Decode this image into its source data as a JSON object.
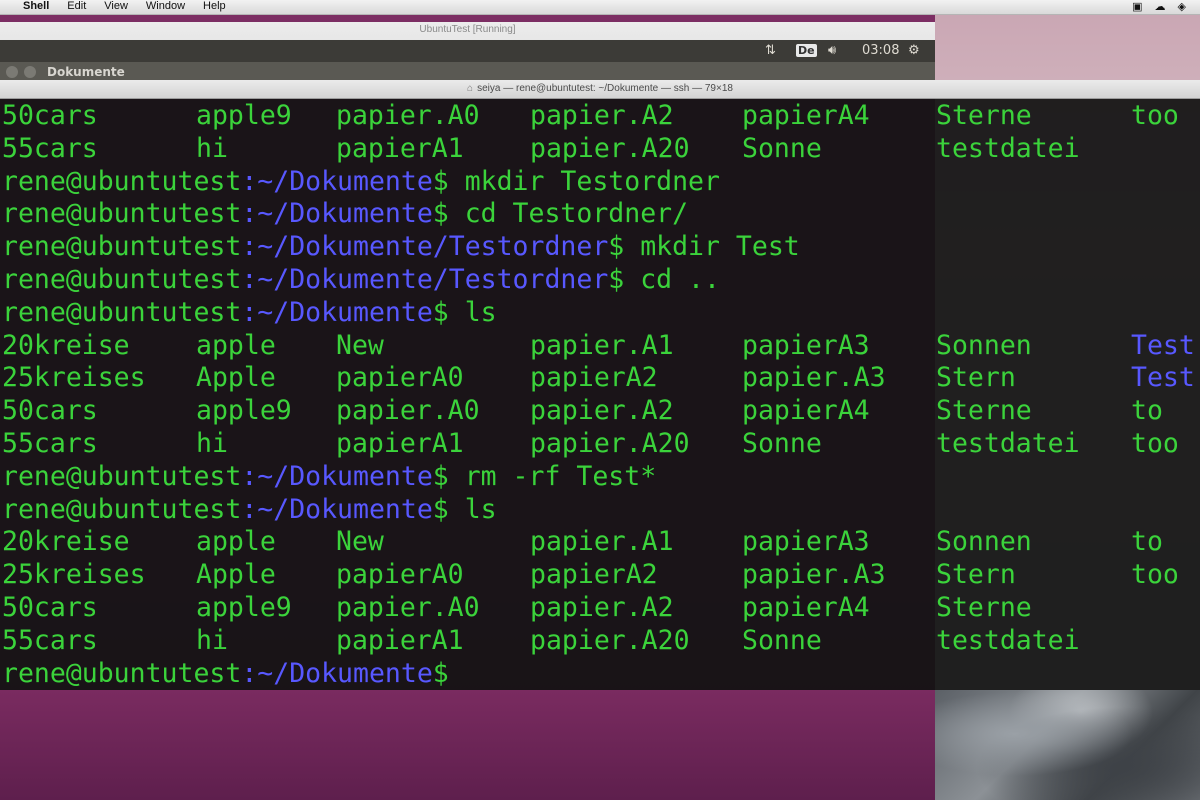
{
  "menubar": {
    "items": [
      "Shell",
      "Edit",
      "View",
      "Window",
      "Help"
    ],
    "tray_icons": [
      "screen-share-icon",
      "cloud-icon",
      "dropbox-icon"
    ]
  },
  "vbox": {
    "title": "UbuntuTest [Running]",
    "clock": "03:08",
    "keyboard": "De",
    "files_window_title": "Dokumente"
  },
  "terminal": {
    "title": "seiya — rene@ubuntutest: ~/Dokumente — ssh — 79×18",
    "prompt_host": "rene@ubuntutest",
    "lines": [
      {
        "kind": "files",
        "cells": [
          "50cars",
          "apple9",
          "papier.A0",
          "papier.A2",
          "papierA4",
          "Sterne",
          "too"
        ]
      },
      {
        "kind": "files",
        "cells": [
          "55cars",
          "hi",
          "papierA1",
          "papier.A20",
          "Sonne",
          "testdatei",
          ""
        ]
      },
      {
        "kind": "prompt",
        "path": ":~/Dokumente",
        "cmd": "$ mkdir Testordner"
      },
      {
        "kind": "prompt",
        "path": ":~/Dokumente",
        "cmd": "$ cd Testordner/"
      },
      {
        "kind": "prompt",
        "path": ":~/Dokumente/Testordner",
        "cmd": "$ mkdir Test"
      },
      {
        "kind": "prompt",
        "path": ":~/Dokumente/Testordner",
        "cmd": "$ cd .."
      },
      {
        "kind": "prompt",
        "path": ":~/Dokumente",
        "cmd": "$ ls"
      },
      {
        "kind": "files",
        "cells": [
          "20kreise",
          "apple",
          "New",
          "papier.A1",
          "papierA3",
          "Sonnen",
          "Test"
        ],
        "blue_last": true
      },
      {
        "kind": "files",
        "cells": [
          "25kreises",
          "Apple",
          "papierA0",
          "papierA2",
          "papier.A3",
          "Stern",
          "Test"
        ],
        "blue_last": true
      },
      {
        "kind": "files",
        "cells": [
          "50cars",
          "apple9",
          "papier.A0",
          "papier.A2",
          "papierA4",
          "Sterne",
          "to"
        ]
      },
      {
        "kind": "files",
        "cells": [
          "55cars",
          "hi",
          "papierA1",
          "papier.A20",
          "Sonne",
          "testdatei",
          "too"
        ]
      },
      {
        "kind": "prompt",
        "path": ":~/Dokumente",
        "cmd": "$ rm -rf Test*"
      },
      {
        "kind": "prompt",
        "path": ":~/Dokumente",
        "cmd": "$ ls"
      },
      {
        "kind": "files",
        "cells": [
          "20kreise",
          "apple",
          "New",
          "papier.A1",
          "papierA3",
          "Sonnen",
          "to"
        ]
      },
      {
        "kind": "files",
        "cells": [
          "25kreises",
          "Apple",
          "papierA0",
          "papierA2",
          "papier.A3",
          "Stern",
          "too"
        ]
      },
      {
        "kind": "files",
        "cells": [
          "50cars",
          "apple9",
          "papier.A0",
          "papier.A2",
          "papierA4",
          "Sterne",
          ""
        ]
      },
      {
        "kind": "files",
        "cells": [
          "55cars",
          "hi",
          "papierA1",
          "papier.A20",
          "Sonne",
          "testdatei",
          ""
        ]
      },
      {
        "kind": "prompt",
        "path": ":~/Dokumente",
        "cmd": "$"
      }
    ]
  },
  "colors": {
    "terminal_text": "#3bd33b",
    "path_color": "#5858ff",
    "terminal_bg": "#121212"
  }
}
